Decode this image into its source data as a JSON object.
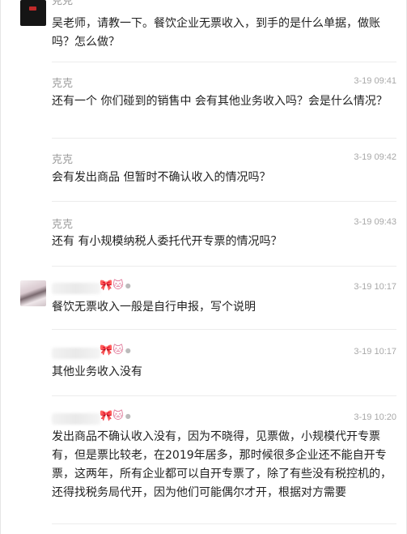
{
  "messages": [
    {
      "sender": "克克",
      "time": "",
      "text": "吴老师，请教一下。餐饮企业无票收入，到手的是什么单据，做账吗？怎么做？"
    },
    {
      "sender": "克克",
      "time": "3-19 09:41",
      "text": "还有一个  你们碰到的销售中  会有其他业务收入吗？会是什么情况？"
    },
    {
      "sender": "克克",
      "time": "3-19 09:42",
      "text": "会有发出商品 但暂时不确认收入的情况吗？"
    },
    {
      "sender": "克克",
      "time": "3-19 09:43",
      "text": "还有 有小规模纳税人委托代开专票的情况吗？"
    },
    {
      "sender_emoji": "🎀🐱",
      "time": "3-19 10:17",
      "text": "餐饮无票收入一般是自行申报，写个说明"
    },
    {
      "sender_emoji": "🎀🐱",
      "time": "3-19 10:17",
      "text": "其他业务收入没有"
    },
    {
      "sender_emoji": "🎀🐱",
      "time": "3-19 10:20",
      "text": "发出商品不确认收入没有，因为不晓得，见票做，小规模代开专票有，但是票比较老，在2019年居多，那时候很多企业还不能自开专票，这两年，所有企业都可以自开专票了，除了有些没有税控机的，还得找税务局代开，因为他们可能偶尔才开，根据对方需要"
    }
  ]
}
